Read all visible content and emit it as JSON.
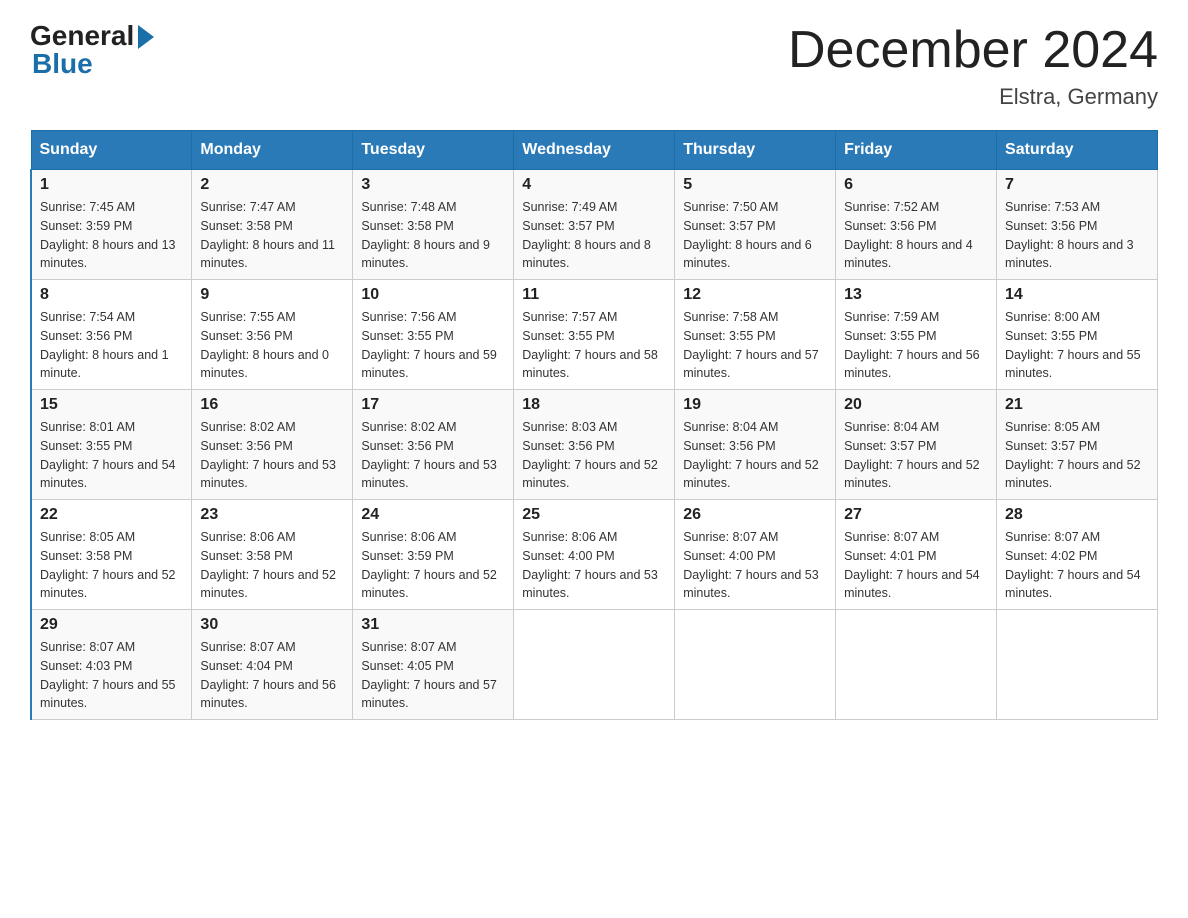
{
  "header": {
    "logo_general": "General",
    "logo_blue": "Blue",
    "month_title": "December 2024",
    "location": "Elstra, Germany"
  },
  "days_of_week": [
    "Sunday",
    "Monday",
    "Tuesday",
    "Wednesday",
    "Thursday",
    "Friday",
    "Saturday"
  ],
  "weeks": [
    [
      {
        "day": "1",
        "sunrise": "7:45 AM",
        "sunset": "3:59 PM",
        "daylight": "8 hours and 13 minutes."
      },
      {
        "day": "2",
        "sunrise": "7:47 AM",
        "sunset": "3:58 PM",
        "daylight": "8 hours and 11 minutes."
      },
      {
        "day": "3",
        "sunrise": "7:48 AM",
        "sunset": "3:58 PM",
        "daylight": "8 hours and 9 minutes."
      },
      {
        "day": "4",
        "sunrise": "7:49 AM",
        "sunset": "3:57 PM",
        "daylight": "8 hours and 8 minutes."
      },
      {
        "day": "5",
        "sunrise": "7:50 AM",
        "sunset": "3:57 PM",
        "daylight": "8 hours and 6 minutes."
      },
      {
        "day": "6",
        "sunrise": "7:52 AM",
        "sunset": "3:56 PM",
        "daylight": "8 hours and 4 minutes."
      },
      {
        "day": "7",
        "sunrise": "7:53 AM",
        "sunset": "3:56 PM",
        "daylight": "8 hours and 3 minutes."
      }
    ],
    [
      {
        "day": "8",
        "sunrise": "7:54 AM",
        "sunset": "3:56 PM",
        "daylight": "8 hours and 1 minute."
      },
      {
        "day": "9",
        "sunrise": "7:55 AM",
        "sunset": "3:56 PM",
        "daylight": "8 hours and 0 minutes."
      },
      {
        "day": "10",
        "sunrise": "7:56 AM",
        "sunset": "3:55 PM",
        "daylight": "7 hours and 59 minutes."
      },
      {
        "day": "11",
        "sunrise": "7:57 AM",
        "sunset": "3:55 PM",
        "daylight": "7 hours and 58 minutes."
      },
      {
        "day": "12",
        "sunrise": "7:58 AM",
        "sunset": "3:55 PM",
        "daylight": "7 hours and 57 minutes."
      },
      {
        "day": "13",
        "sunrise": "7:59 AM",
        "sunset": "3:55 PM",
        "daylight": "7 hours and 56 minutes."
      },
      {
        "day": "14",
        "sunrise": "8:00 AM",
        "sunset": "3:55 PM",
        "daylight": "7 hours and 55 minutes."
      }
    ],
    [
      {
        "day": "15",
        "sunrise": "8:01 AM",
        "sunset": "3:55 PM",
        "daylight": "7 hours and 54 minutes."
      },
      {
        "day": "16",
        "sunrise": "8:02 AM",
        "sunset": "3:56 PM",
        "daylight": "7 hours and 53 minutes."
      },
      {
        "day": "17",
        "sunrise": "8:02 AM",
        "sunset": "3:56 PM",
        "daylight": "7 hours and 53 minutes."
      },
      {
        "day": "18",
        "sunrise": "8:03 AM",
        "sunset": "3:56 PM",
        "daylight": "7 hours and 52 minutes."
      },
      {
        "day": "19",
        "sunrise": "8:04 AM",
        "sunset": "3:56 PM",
        "daylight": "7 hours and 52 minutes."
      },
      {
        "day": "20",
        "sunrise": "8:04 AM",
        "sunset": "3:57 PM",
        "daylight": "7 hours and 52 minutes."
      },
      {
        "day": "21",
        "sunrise": "8:05 AM",
        "sunset": "3:57 PM",
        "daylight": "7 hours and 52 minutes."
      }
    ],
    [
      {
        "day": "22",
        "sunrise": "8:05 AM",
        "sunset": "3:58 PM",
        "daylight": "7 hours and 52 minutes."
      },
      {
        "day": "23",
        "sunrise": "8:06 AM",
        "sunset": "3:58 PM",
        "daylight": "7 hours and 52 minutes."
      },
      {
        "day": "24",
        "sunrise": "8:06 AM",
        "sunset": "3:59 PM",
        "daylight": "7 hours and 52 minutes."
      },
      {
        "day": "25",
        "sunrise": "8:06 AM",
        "sunset": "4:00 PM",
        "daylight": "7 hours and 53 minutes."
      },
      {
        "day": "26",
        "sunrise": "8:07 AM",
        "sunset": "4:00 PM",
        "daylight": "7 hours and 53 minutes."
      },
      {
        "day": "27",
        "sunrise": "8:07 AM",
        "sunset": "4:01 PM",
        "daylight": "7 hours and 54 minutes."
      },
      {
        "day": "28",
        "sunrise": "8:07 AM",
        "sunset": "4:02 PM",
        "daylight": "7 hours and 54 minutes."
      }
    ],
    [
      {
        "day": "29",
        "sunrise": "8:07 AM",
        "sunset": "4:03 PM",
        "daylight": "7 hours and 55 minutes."
      },
      {
        "day": "30",
        "sunrise": "8:07 AM",
        "sunset": "4:04 PM",
        "daylight": "7 hours and 56 minutes."
      },
      {
        "day": "31",
        "sunrise": "8:07 AM",
        "sunset": "4:05 PM",
        "daylight": "7 hours and 57 minutes."
      },
      null,
      null,
      null,
      null
    ]
  ],
  "labels": {
    "sunrise": "Sunrise:",
    "sunset": "Sunset:",
    "daylight": "Daylight:"
  }
}
